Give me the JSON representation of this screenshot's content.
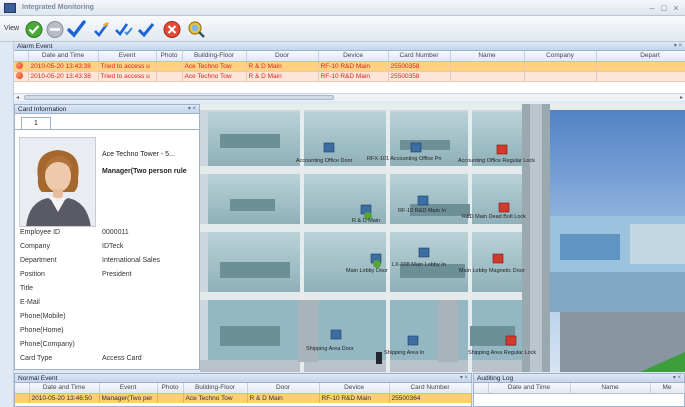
{
  "window": {
    "title": "Integrated Monitoring"
  },
  "toolbar": {
    "view_label": "View",
    "buttons": [
      "check-green-icon",
      "disabled-icon",
      "check-blue-icon",
      "edit-check-icon",
      "check-multi-icon",
      "check-icon",
      "cancel-icon",
      "search-icon"
    ]
  },
  "alarm_panel": {
    "title": "Alarm Event",
    "columns": [
      "Date and Time",
      "Event",
      "Photo",
      "Building-Floor",
      "Door",
      "Device",
      "Card Number",
      "Name",
      "Company",
      "Depart"
    ],
    "rows": [
      [
        "2010-05-20 13:43:38",
        "Tried to access u",
        "",
        "Ace Techno Tow",
        "R & D Main",
        "RF-10 R&D Main",
        "25500358",
        "",
        "",
        ""
      ],
      [
        "2010-05-20 13:43:38",
        "Tried to access u",
        "",
        "Ace Techno Tow",
        "R & D Main",
        "RF-10 R&D Main",
        "25500358",
        "",
        "",
        ""
      ]
    ]
  },
  "card_panel": {
    "title": "Card Information",
    "tab": "1",
    "building": "Ace Techno Tower - 5...",
    "card_holder_type": "Manager(Two person rule",
    "fields": [
      {
        "label": "Employee ID",
        "value": "0000011"
      },
      {
        "label": "Company",
        "value": "IDTeck"
      },
      {
        "label": "Department",
        "value": "International Sales"
      },
      {
        "label": "Position",
        "value": "President"
      },
      {
        "label": "Title",
        "value": ""
      },
      {
        "label": "E-Mail",
        "value": ""
      },
      {
        "label": "Phone(Mobile)",
        "value": ""
      },
      {
        "label": "Phone(Home)",
        "value": ""
      },
      {
        "label": "Phone(Company)",
        "value": ""
      },
      {
        "label": "Card Type",
        "value": "Access Card"
      }
    ]
  },
  "map_labels": [
    "Accounting Office Door",
    "RFX-101 Accounting Office Pn",
    "Accounting Office Regular Lock",
    "R & D Main",
    "RF-10 R&D Main In",
    "R&D Main Dead Bolt Lock",
    "Main Lobby Door",
    "LX-008 Main Lobby In",
    "Main Lobby Magnetic Door",
    "Shipping Area Door",
    "Shipping Area In",
    "Shipping Area Regular Lock"
  ],
  "normal_panel": {
    "title": "Normal Event",
    "columns": [
      "Date and Time",
      "Event",
      "Photo",
      "Building-Floor",
      "Door",
      "Device",
      "Card Number"
    ],
    "rows": [
      [
        "2010-05-20 13:46:50",
        "Manager(Two per",
        "",
        "Ace Techno Tow",
        "R & D Main",
        "RF-10 R&D Main",
        "25500364"
      ]
    ]
  },
  "audit_panel": {
    "title": "Auditing Log",
    "columns": [
      "Date and Time",
      "Name",
      "Me"
    ]
  }
}
